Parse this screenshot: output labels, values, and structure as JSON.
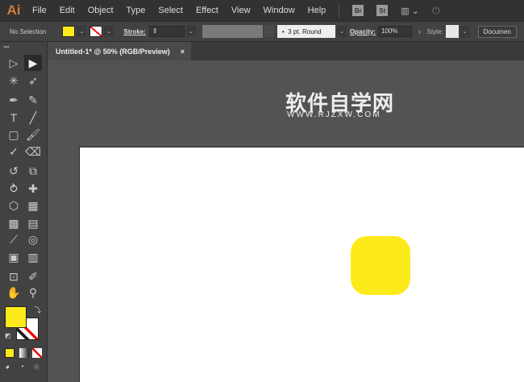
{
  "app": {
    "logo": "Ai"
  },
  "menu": [
    "File",
    "Edit",
    "Object",
    "Type",
    "Select",
    "Effect",
    "View",
    "Window",
    "Help"
  ],
  "menu_badges": [
    "Br",
    "St"
  ],
  "control": {
    "selection": "No Selection",
    "fill_color": "#fcea1b",
    "stroke_label": "Stroke:",
    "brush": "3 pt. Round",
    "opacity_label": "Opacity:",
    "opacity": "100%",
    "style_label": "Style:",
    "document_button": "Documen"
  },
  "document_tab": {
    "title": "Untitled-1* @ 50% (RGB/Preview)",
    "close": "×"
  },
  "watermark": {
    "title": "软件自学网",
    "url": "WWW.RJZXW.COM"
  },
  "tools": [
    {
      "name": "direct-selection",
      "glyph": "▷"
    },
    {
      "name": "selection",
      "glyph": "▶"
    },
    {
      "name": "magic-wand",
      "glyph": "✳"
    },
    {
      "name": "lasso",
      "glyph": "➶"
    },
    {
      "name": "pen",
      "glyph": "✒"
    },
    {
      "name": "curvature",
      "glyph": "✎"
    },
    {
      "name": "type",
      "glyph": "T"
    },
    {
      "name": "line",
      "glyph": "╱"
    },
    {
      "name": "rectangle",
      "glyph": "▢"
    },
    {
      "name": "paintbrush",
      "glyph": "🖌"
    },
    {
      "name": "shaper",
      "glyph": "✓"
    },
    {
      "name": "eraser",
      "glyph": "⌫"
    },
    {
      "name": "rotate",
      "glyph": "↺"
    },
    {
      "name": "scale",
      "glyph": "⧉"
    },
    {
      "name": "warp",
      "glyph": "⥁"
    },
    {
      "name": "puppet-warp",
      "glyph": "✚"
    },
    {
      "name": "shape-builder",
      "glyph": "⬡"
    },
    {
      "name": "perspective-grid",
      "glyph": "▦"
    },
    {
      "name": "mesh",
      "glyph": "▩"
    },
    {
      "name": "gradient",
      "glyph": "▤"
    },
    {
      "name": "eyedropper",
      "glyph": "⟋"
    },
    {
      "name": "blend",
      "glyph": "◎"
    },
    {
      "name": "symbol-sprayer",
      "glyph": "▣"
    },
    {
      "name": "column-graph",
      "glyph": "▥"
    },
    {
      "name": "artboard",
      "glyph": "⊡"
    },
    {
      "name": "slice",
      "glyph": "✐"
    },
    {
      "name": "hand",
      "glyph": "✋"
    },
    {
      "name": "zoom",
      "glyph": "⚲"
    }
  ],
  "colors": {
    "fill": "#fcea1b",
    "stroke": "none"
  }
}
